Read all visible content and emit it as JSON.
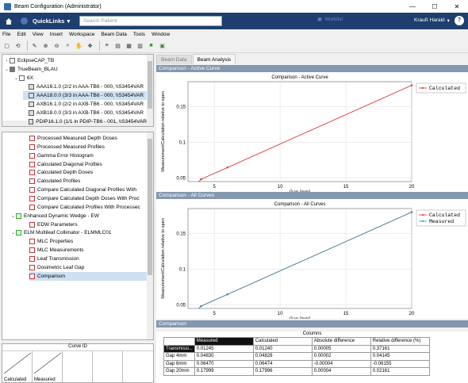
{
  "window": {
    "title": "Beam Configuration (Administrator)",
    "minimize": "—",
    "maximize": "☐",
    "close": "✕"
  },
  "topbar": {
    "quicklinks": "QuickLinks",
    "search_placeholder": "Search Patient",
    "worklist": "Worklist",
    "user": "Krauß Harald",
    "help": "?"
  },
  "menu": [
    "File",
    "Edit",
    "View",
    "Insert",
    "Workspace",
    "Beam Data",
    "Tools",
    "Window"
  ],
  "toolbar_icons": [
    "new-icon",
    "open-icon",
    "tools-icon",
    "zoom-in-icon",
    "zoom-out-icon",
    "search-icon",
    "hand-icon",
    "arrows-icon",
    "ruler-icon",
    "table-icon",
    "grid-icon",
    "chart-icon",
    "check-icon",
    "stop-icon"
  ],
  "tree_top": {
    "items": [
      {
        "toggle": ">",
        "label": "EclipseCAP_TB"
      },
      {
        "toggle": "v",
        "label": "TrueBeam_BLAU"
      },
      {
        "toggle": "v",
        "label": "6X"
      },
      {
        "label": "AAA16.1.0 (2/2 in AAA-TB6 - 000, \\\\S3454VAR"
      },
      {
        "label": "AAA18.0.0 (3/3 in AAA-TB6 - 000, \\\\S3454VAR"
      },
      {
        "label": "AXB16.1.0 (2/2 in AXB-TB6 - 000, \\\\S3454VAR"
      },
      {
        "label": "AXB18.0.0 (3/3 in AXB-TB6 - 000, \\\\S3454VAR"
      },
      {
        "label": "PDIP16.1.0 (1/1 in PDIP-TB6 - 001, \\\\S3454VAR"
      }
    ]
  },
  "tree_bottom": {
    "items": [
      {
        "label": "Processed Measured Depth Doses"
      },
      {
        "label": "Processed Measured Profiles"
      },
      {
        "label": "Gamma Error Histogram"
      },
      {
        "label": "Calculated Diagonal Profiles"
      },
      {
        "label": "Calculated Depth Doses"
      },
      {
        "label": "Calculated Profiles"
      },
      {
        "label": "Compare Calculated Diagonal Profiles With"
      },
      {
        "label": "Compare Calculated Depth Doses With Proc"
      },
      {
        "label": "Compare Calculated Profiles With Processec"
      },
      {
        "label": "Enhanced Dynamic Wedge - EW"
      },
      {
        "label": "EDW Parameters"
      },
      {
        "label": "ELM Multileaf Collimator - ELMMLC01"
      },
      {
        "label": "MLC Properties"
      },
      {
        "label": "MLC Measurements"
      },
      {
        "label": "Leaf Transmission"
      },
      {
        "label": "Dosimetric Leaf Gap"
      },
      {
        "label": "Comparison"
      }
    ]
  },
  "curve_panel": {
    "title": "Curve ID",
    "cells": [
      "Calculated",
      "Measured"
    ]
  },
  "tabs": [
    "Beam Data",
    "Beam Analysis"
  ],
  "sections": {
    "active": "Comparison - Active Curve",
    "all": "Comparison - All Curves",
    "table": "Comparison"
  },
  "chart_data": [
    {
      "type": "line",
      "title": "Comparison - Active Curve",
      "xlabel": "Gap [mm]",
      "ylabel": "Measurement/Calculation relative to open",
      "xlim": [
        3,
        20
      ],
      "ylim": [
        0.045,
        0.185
      ],
      "xticks": [
        5,
        10,
        15,
        20
      ],
      "yticks": [
        0.05,
        0.1,
        0.15
      ],
      "grid": true,
      "legend": "top-right",
      "series": [
        {
          "name": "Calculated",
          "color": "#e02020",
          "x": [
            2,
            4,
            6,
            20
          ],
          "y": [
            0.0125,
            0.0483,
            0.0647,
            0.17996
          ]
        }
      ]
    },
    {
      "type": "line",
      "title": "Comparison - All Curves",
      "xlabel": "Gap [mm]",
      "ylabel": "Measurement/Calculation relative to open",
      "xlim": [
        3,
        20
      ],
      "ylim": [
        0.045,
        0.185
      ],
      "xticks": [
        5,
        10,
        15,
        20
      ],
      "yticks": [
        0.05,
        0.1,
        0.15
      ],
      "grid": true,
      "legend": "top-right",
      "series": [
        {
          "name": "Calculated",
          "color": "#e02020",
          "x": [
            2,
            4,
            6,
            20
          ],
          "y": [
            0.0124,
            0.04828,
            0.06474,
            0.17996
          ]
        },
        {
          "name": "Measured",
          "color": "#2a8fa8",
          "x": [
            2,
            4,
            6,
            20
          ],
          "y": [
            0.01245,
            0.0483,
            0.0647,
            0.17999
          ]
        }
      ]
    }
  ],
  "results_table": {
    "title": "Columns",
    "headers": [
      "",
      "Measured",
      "Calculated",
      "Absolute difference",
      "Relative difference (%)"
    ],
    "rows": [
      [
        "Transmissi...",
        "0.01245",
        "0.01240",
        "0.00005",
        "0.37161"
      ],
      [
        "Gap 4mm",
        "0.04830",
        "0.04828",
        "0.00002",
        "0.04145"
      ],
      [
        "Gap 6mm",
        "0.06470",
        "0.06474",
        "-0.00004",
        "-0.06155"
      ],
      [
        "Gap 20mm",
        "0.17999",
        "0.17996",
        "0.00004",
        "0.02161"
      ]
    ]
  }
}
